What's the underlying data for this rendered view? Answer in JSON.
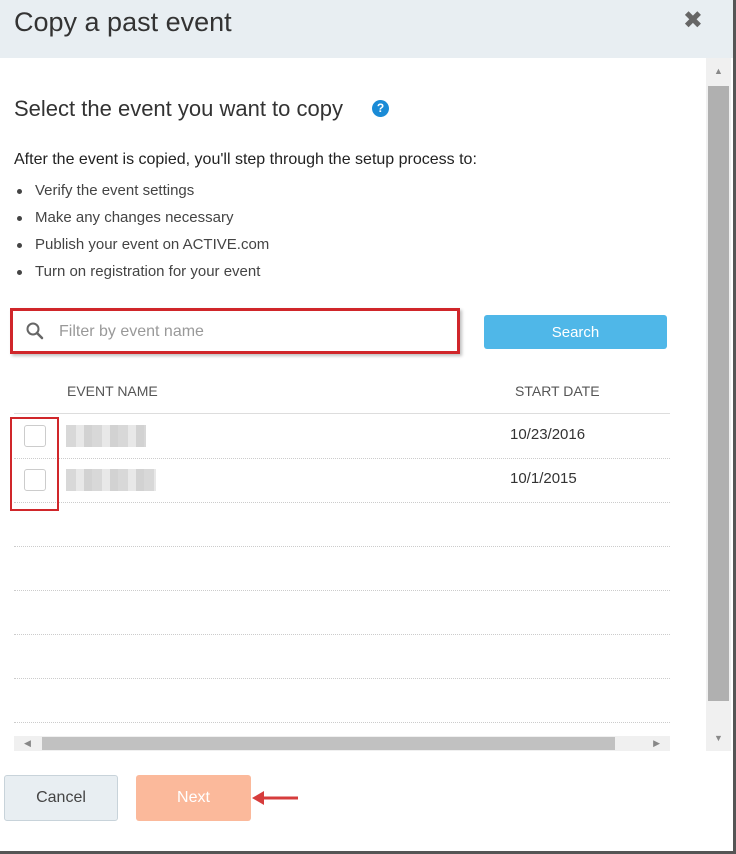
{
  "dialog": {
    "title": "Copy a past event",
    "close_icon": "close-icon",
    "heading": "Select the event you want to copy",
    "help_icon_glyph": "?",
    "intro": "After the event is copied, you'll step through the setup process to:",
    "steps": [
      "Verify the event settings",
      "Make any changes necessary",
      "Publish your event on ACTIVE.com",
      "Turn on registration for your event"
    ]
  },
  "filter": {
    "placeholder": "Filter by event name",
    "value": "",
    "icon": "search-icon"
  },
  "search_button": {
    "label": "Search"
  },
  "table": {
    "columns": [
      "EVENT NAME",
      "START DATE"
    ],
    "rows": [
      {
        "name": "",
        "start_date": "10/23/2016",
        "checked": false
      },
      {
        "name": "",
        "start_date": "10/1/2015",
        "checked": false
      }
    ]
  },
  "footer": {
    "cancel_label": "Cancel",
    "next_label": "Next"
  },
  "colors": {
    "header_bg": "#e8eef2",
    "search_button": "#4fb7e8",
    "next_button": "#fbb99b",
    "highlight": "#d0262a",
    "help_icon": "#1a8bd6"
  }
}
